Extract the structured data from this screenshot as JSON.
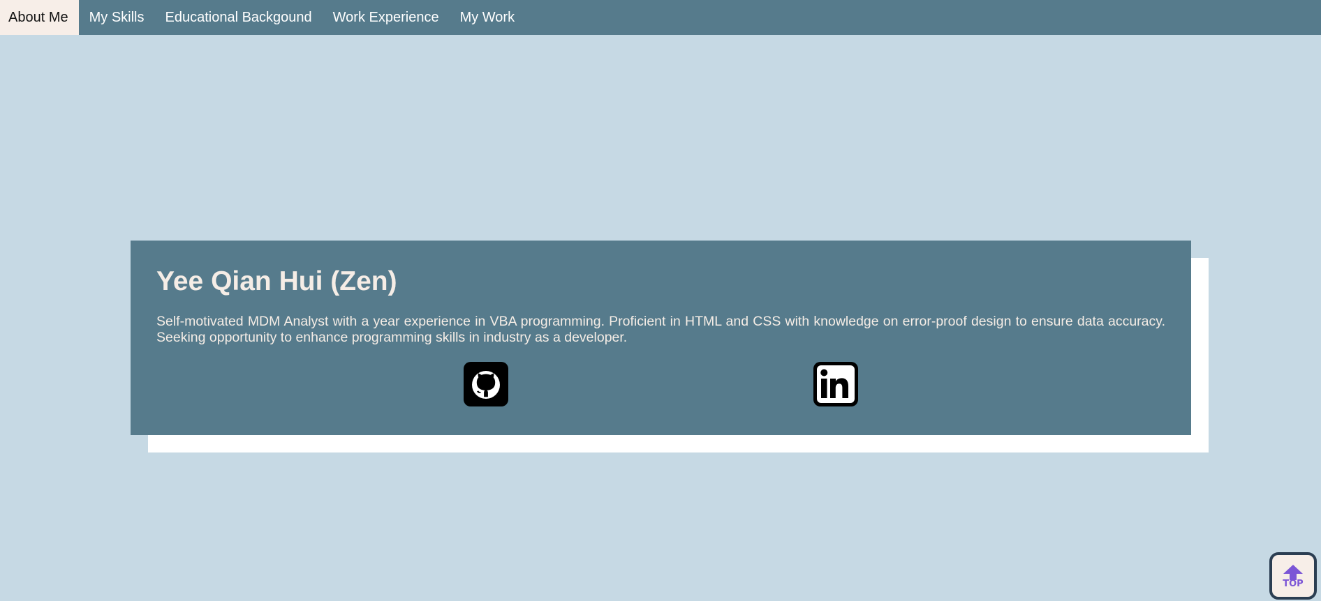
{
  "nav": {
    "items": [
      {
        "label": "About Me",
        "active": true
      },
      {
        "label": "My Skills"
      },
      {
        "label": "Educational Backgound"
      },
      {
        "label": "Work Experience"
      },
      {
        "label": "My Work"
      }
    ]
  },
  "profile": {
    "name": "Yee Qian Hui (Zen)",
    "summary": "Self-motivated MDM Analyst with a year experience in VBA programming. Proficient in HTML and CSS with knowledge on error-proof design to ensure data accuracy. Seeking opportunity to enhance programming skills in industry as a developer.",
    "links": [
      {
        "icon": "github-icon"
      },
      {
        "icon": "linkedin-icon"
      }
    ]
  },
  "top_button": {
    "label": "TOP",
    "icon": "arrow-up-icon"
  },
  "colors": {
    "background": "#c6d9e4",
    "nav_bg": "#567b8c",
    "active_nav_bg": "#f7eee8",
    "card_bg": "#567b8c",
    "card_text": "#f5ede6",
    "top_accent": "#7b55d6"
  }
}
